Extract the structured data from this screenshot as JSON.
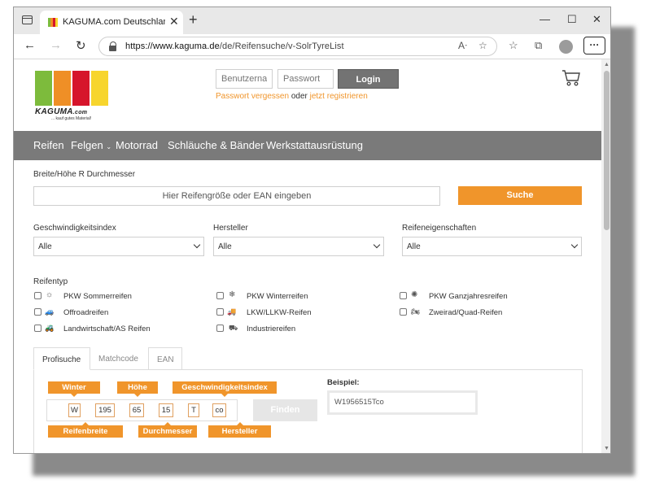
{
  "browser": {
    "tab_title": "KAGUMA.com Deutschland | Reif",
    "url_prefix": "https://www.kaguma.de",
    "url_path": "/de/Reifensuche/v-SolrTyreList",
    "icons": [
      "tab-actions-icon",
      "favicon",
      "close-icon",
      "new-tab-icon",
      "minimize-icon",
      "maximize-icon",
      "window-close-icon",
      "back-icon",
      "forward-icon",
      "refresh-icon",
      "lock-icon",
      "read-aloud-icon",
      "favorite-add-icon",
      "favorites-icon",
      "collections-icon",
      "profile-icon",
      "more-icon"
    ]
  },
  "header": {
    "logo_text": "KAGUMA",
    "logo_suffix": ".com",
    "slogan": "... kauf gutes Material!",
    "logo_colors": [
      "#7dbb3c",
      "#ef8f26",
      "#d6152b",
      "#f7d52d"
    ],
    "username_placeholder": "Benutzername",
    "password_placeholder": "Passwort",
    "login_label": "Login",
    "forgot_label": "Passwort vergessen",
    "or_label": "oder",
    "register_label": "jetzt registrieren",
    "accent": "#f0952b"
  },
  "nav": {
    "items": [
      "Reifen",
      "Felgen",
      "Motorrad",
      "Schläuche & Bänder",
      "Werkstattausrüstung"
    ]
  },
  "search": {
    "size_label": "Breite/Höhe R Durchmesser",
    "placeholder": "Hier Reifengröße oder EAN eingeben",
    "button": "Suche",
    "speed_label": "Geschwindigkeitsindex",
    "maker_label": "Hersteller",
    "props_label": "Reifeneigenschaften",
    "speed_value": "Alle",
    "maker_value": "Alle",
    "props_value": "Alle"
  },
  "tyre_types": {
    "label": "Reifentyp",
    "items": [
      "PKW Sommerreifen",
      "PKW Winterreifen",
      "PKW Ganzjahresreifen",
      "Offroadreifen",
      "LKW/LLKW-Reifen",
      "Zweirad/Quad-Reifen",
      "Landwirtschaft/AS Reifen",
      "Industriereifen"
    ]
  },
  "profile": {
    "tabs": [
      "Profisuche",
      "Matchcode",
      "EAN"
    ],
    "tags_top": [
      "Winter",
      "Höhe",
      "Geschwindigkeitsindex"
    ],
    "tags_bottom": [
      "Reifenbreite",
      "Durchmesser",
      "Hersteller"
    ],
    "cells": [
      "W",
      "195",
      "65",
      "15",
      "T",
      "co"
    ],
    "find_button": "Finden",
    "example_label": "Beispiel:",
    "example_value": "W1956515Tco"
  }
}
